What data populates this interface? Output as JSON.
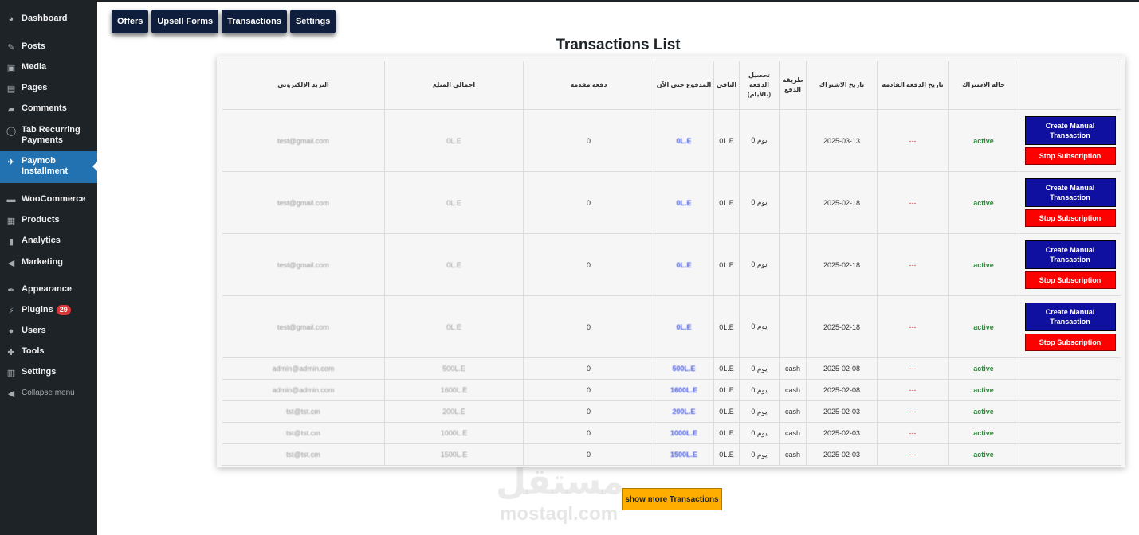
{
  "sidebar": {
    "items": [
      {
        "label": "Dashboard",
        "icon": "dashboard-icon",
        "glyph": "◕"
      },
      {
        "label": "Posts",
        "icon": "pin-icon",
        "glyph": "✎"
      },
      {
        "label": "Media",
        "icon": "media-icon",
        "glyph": "▣"
      },
      {
        "label": "Pages",
        "icon": "pages-icon",
        "glyph": "▤"
      },
      {
        "label": "Comments",
        "icon": "comments-icon",
        "glyph": "▰"
      },
      {
        "label": "Tab Recurring Payments",
        "icon": "circle-icon",
        "glyph": "◯"
      },
      {
        "label": "Paymob Installment",
        "icon": "paymob-icon",
        "glyph": "✈"
      },
      {
        "label": "WooCommerce",
        "icon": "woocommerce-icon",
        "glyph": "▬"
      },
      {
        "label": "Products",
        "icon": "products-icon",
        "glyph": "▦"
      },
      {
        "label": "Analytics",
        "icon": "analytics-icon",
        "glyph": "▮"
      },
      {
        "label": "Marketing",
        "icon": "marketing-icon",
        "glyph": "◀"
      },
      {
        "label": "Appearance",
        "icon": "brush-icon",
        "glyph": "✒"
      },
      {
        "label": "Plugins",
        "icon": "plugin-icon",
        "glyph": "⚡",
        "badge": "29"
      },
      {
        "label": "Users",
        "icon": "users-icon",
        "glyph": "●"
      },
      {
        "label": "Tools",
        "icon": "wrench-icon",
        "glyph": "✚"
      },
      {
        "label": "Settings",
        "icon": "settings-icon",
        "glyph": "▥"
      },
      {
        "label": "Collapse menu",
        "icon": "collapse-icon",
        "glyph": "◀"
      }
    ]
  },
  "tabs": [
    "Offers",
    "Upsell Forms",
    "Transactions",
    "Settings"
  ],
  "page_title": "Transactions List",
  "table": {
    "headers": [
      "البريد الإلكتروني",
      "اجمالي المبلغ",
      "دفعة مقدمة",
      "المدفوع حتى الآن",
      "الباقي",
      "تحصيل الدفعة (بالأيام)",
      "طريقة الدفع",
      "تاريخ الاشتراك",
      "تاريخ الدفعة القادمة",
      "حالة الاشتراك",
      ""
    ],
    "rows": [
      {
        "email": "test@gmail.com",
        "total": "0L.E",
        "down": "0",
        "paid": "0L.E",
        "remaining": "0L.E",
        "days": "0 يوم",
        "method": "",
        "date": "2025-03-13",
        "next": "---",
        "status": "active",
        "actions": true
      },
      {
        "email": "test@gmail.com",
        "total": "0L.E",
        "down": "0",
        "paid": "0L.E",
        "remaining": "0L.E",
        "days": "0 يوم",
        "method": "",
        "date": "2025-02-18",
        "next": "---",
        "status": "active",
        "actions": true
      },
      {
        "email": "test@gmail.com",
        "total": "0L.E",
        "down": "0",
        "paid": "0L.E",
        "remaining": "0L.E",
        "days": "0 يوم",
        "method": "",
        "date": "2025-02-18",
        "next": "---",
        "status": "active",
        "actions": true
      },
      {
        "email": "test@gmail.com",
        "total": "0L.E",
        "down": "0",
        "paid": "0L.E",
        "remaining": "0L.E",
        "days": "0 يوم",
        "method": "",
        "date": "2025-02-18",
        "next": "---",
        "status": "active",
        "actions": true
      },
      {
        "email": "admin@admin.com",
        "total": "500L.E",
        "down": "0",
        "paid": "500L.E",
        "remaining": "0L.E",
        "days": "0 يوم",
        "method": "cash",
        "date": "2025-02-08",
        "next": "---",
        "status": "active",
        "actions": false
      },
      {
        "email": "admin@admin.com",
        "total": "1600L.E",
        "down": "0",
        "paid": "1600L.E",
        "remaining": "0L.E",
        "days": "0 يوم",
        "method": "cash",
        "date": "2025-02-08",
        "next": "---",
        "status": "active",
        "actions": false
      },
      {
        "email": "tst@tst.cm",
        "total": "200L.E",
        "down": "0",
        "paid": "200L.E",
        "remaining": "0L.E",
        "days": "0 يوم",
        "method": "cash",
        "date": "2025-02-03",
        "next": "---",
        "status": "active",
        "actions": false
      },
      {
        "email": "tst@tst.cm",
        "total": "1000L.E",
        "down": "0",
        "paid": "1000L.E",
        "remaining": "0L.E",
        "days": "0 يوم",
        "method": "cash",
        "date": "2025-02-03",
        "next": "---",
        "status": "active",
        "actions": false
      },
      {
        "email": "tst@tst.cm",
        "total": "1500L.E",
        "down": "0",
        "paid": "1500L.E",
        "remaining": "0L.E",
        "days": "0 يوم",
        "method": "cash",
        "date": "2025-02-03",
        "next": "---",
        "status": "active",
        "actions": false
      }
    ],
    "create_label": "Create Manual Transaction",
    "stop_label": "Stop Subscription"
  },
  "show_more_label": "show more Transactions",
  "watermark": {
    "arabic": "مستقل",
    "latin": "mostaql.com"
  },
  "colors": {
    "sidebar": "#1d2327",
    "active": "#2271b1",
    "create": "#1010a0",
    "stop": "#ff0000",
    "more": "#ffae00",
    "status": "#2e8b3a"
  }
}
